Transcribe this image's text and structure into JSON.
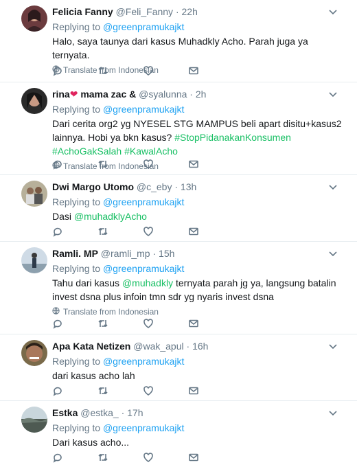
{
  "colors": {
    "link": "#1da1f2",
    "hashtag": "#17bf63",
    "muted": "#657786",
    "heart": "#e0245e"
  },
  "tweets": [
    {
      "name": "Felicia Fanny",
      "handle": "@Feli_Fanny",
      "time": "22h",
      "replying_prefix": "Replying to",
      "replying_to": "@greenpramukajkt",
      "text": "Halo, saya taunya dari kasus Muhadkly Acho. Parah juga ya ternyata.",
      "translate": "Translate from Indonesian"
    },
    {
      "name": "rina",
      "name_suffix": "mama zac &",
      "handle": "@syalunna",
      "time": "2h",
      "replying_prefix": "Replying to",
      "replying_to": "@greenpramukajkt",
      "text_plain": "Dari cerita org2 yg NYESEL STG MAMPUS beli apart disitu+kasus2 lainnya. Hobi ya bkn kasus?",
      "hashtags": [
        "#StopPidanakanKonsumen",
        "#AchoGakSalah",
        "#KawalAcho"
      ],
      "translate": "Translate from Indonesian"
    },
    {
      "name": "Dwi Margo Utomo",
      "handle": "@c_eby",
      "time": "13h",
      "replying_prefix": "Replying to",
      "replying_to": "@greenpramukajkt",
      "text_plain": "Dasi",
      "mention": "@muhadklyAcho"
    },
    {
      "name": "Ramli. MP",
      "handle": "@ramli_mp",
      "time": "15h",
      "replying_prefix": "Replying to",
      "replying_to": "@greenpramukajkt",
      "text_before": "Tahu dari kasus",
      "mention": "@muhadkly",
      "text_after": "ternyata parah jg ya, langsung batalin invest dsna plus infoin tmn sdr yg nyaris invest dsna",
      "translate": "Translate from Indonesian"
    },
    {
      "name": "Apa Kata Netizen",
      "handle": "@wak_apul",
      "time": "16h",
      "replying_prefix": "Replying to",
      "replying_to": "@greenpramukajkt",
      "text": "dari kasus acho lah"
    },
    {
      "name": "Estka",
      "handle": "@estka_",
      "time": "17h",
      "replying_prefix": "Replying to",
      "replying_to": "@greenpramukajkt",
      "text": "Dari kasus acho..."
    }
  ]
}
